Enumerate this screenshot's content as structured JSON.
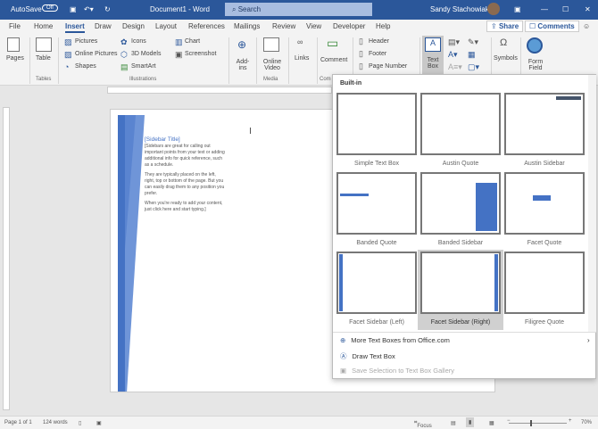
{
  "titlebar": {
    "autosave": "AutoSave",
    "autosave_state": "Off",
    "doc_title": "Document1 - Word",
    "search_placeholder": "Search",
    "user": "Sandy Stachowiak"
  },
  "tabs": [
    "File",
    "Home",
    "Insert",
    "Draw",
    "Design",
    "Layout",
    "References",
    "Mailings",
    "Review",
    "View",
    "Developer",
    "Help"
  ],
  "active_tab": "Insert",
  "share": "Share",
  "comments": "Comments",
  "ribbon": {
    "pages": "Pages",
    "table": "Table",
    "pictures": "Pictures",
    "online_pictures": "Online Pictures",
    "shapes": "Shapes",
    "icons": "Icons",
    "models": "3D Models",
    "smartart": "SmartArt",
    "chart": "Chart",
    "screenshot": "Screenshot",
    "addins": "Add-ins",
    "online_video": "Online Video",
    "links": "Links",
    "comment": "Comment",
    "header": "Header",
    "footer": "Footer",
    "page_number": "Page Number",
    "text_box": "Text Box",
    "symbols": "Symbols",
    "form_field": "Form Field",
    "groups": {
      "tables": "Tables",
      "illustrations": "Illustrations",
      "media": "Media",
      "comments": "Com"
    }
  },
  "document": {
    "sidebar_title": "[Sidebar Title]",
    "paragraphs": [
      "[Sidebars are great for calling out important points from your text or adding additional info for quick reference, such as a schedule.",
      "They are typically placed on the left, right, top or bottom of the page. But you can easily drag them to any position you prefer.",
      "When you're ready to add your content, just click here and start typing.]"
    ]
  },
  "gallery": {
    "header": "Built-in",
    "items": [
      "Simple Text Box",
      "Austin Quote",
      "Austin Sidebar",
      "Banded Quote",
      "Banded Sidebar",
      "Facet Quote",
      "Facet Sidebar (Left)",
      "Facet Sidebar (Right)",
      "Filigree Quote"
    ],
    "selected": "Facet Sidebar (Right)",
    "more": "More Text Boxes from Office.com",
    "draw": "Draw Text Box",
    "save": "Save Selection to Text Box Gallery"
  },
  "status": {
    "page": "Page 1 of 1",
    "words": "124 words",
    "focus": "Focus",
    "zoom": "70%"
  },
  "colors": {
    "brand": "#2b579a",
    "accent": "#4472c4"
  }
}
